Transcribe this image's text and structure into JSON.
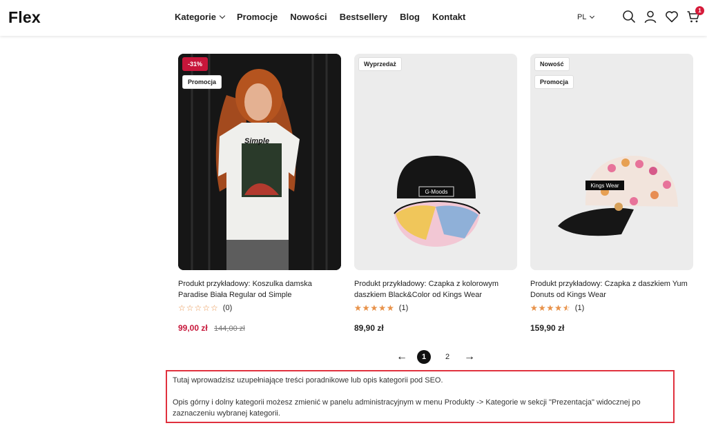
{
  "header": {
    "logo": "Flex",
    "nav": [
      "Kategorie",
      "Promocje",
      "Nowości",
      "Bestsellery",
      "Blog",
      "Kontakt"
    ],
    "language": "PL",
    "cart_count": "1",
    "icons": [
      "search-icon",
      "user-icon",
      "heart-icon",
      "cart-icon"
    ]
  },
  "products": [
    {
      "badges": [
        "-31%",
        "Promocja"
      ],
      "title": "Produkt przykładowy: Koszulka damska Paradise Biała Regular od Simple",
      "rating": 0,
      "reviews": "(0)",
      "price": "99,00 zł",
      "old_price": "144,00 zł",
      "image": "woman-tshirt-photo"
    },
    {
      "badges": [
        "Wyprzedaż"
      ],
      "title": "Produkt przykładowy: Czapka z kolorowym daszkiem Black&Color od Kings Wear",
      "rating": 5,
      "reviews": "(1)",
      "price": "89,90 zł",
      "image_label": "G-Moods",
      "image": "black-cap-photo"
    },
    {
      "badges": [
        "Nowość",
        "Promocja"
      ],
      "title": "Produkt przykładowy: Czapka z daszkiem Yum Donuts od Kings Wear",
      "rating": 4.5,
      "reviews": "(1)",
      "price": "159,90 zł",
      "image_label": "Kings Wear",
      "image": "donut-cap-photo"
    }
  ],
  "pagination": {
    "pages": [
      "1",
      "2"
    ],
    "current": "1",
    "prev": "←",
    "next": "→"
  },
  "description": {
    "p1": "Tutaj wprowadzisz uzupełniające treści poradnikowe lub opis kategorii pod SEO.",
    "p2": "Opis górny i dolny kategorii możesz zmienić w panelu administracyjnym w menu Produkty -> Kategorie w sekcji \"Prezentacja\" widocznej po zaznaczeniu wybranej kategorii."
  },
  "colors": {
    "accent": "#c7163a",
    "star": "#e8924a",
    "highlight_border": "#e0303d"
  }
}
